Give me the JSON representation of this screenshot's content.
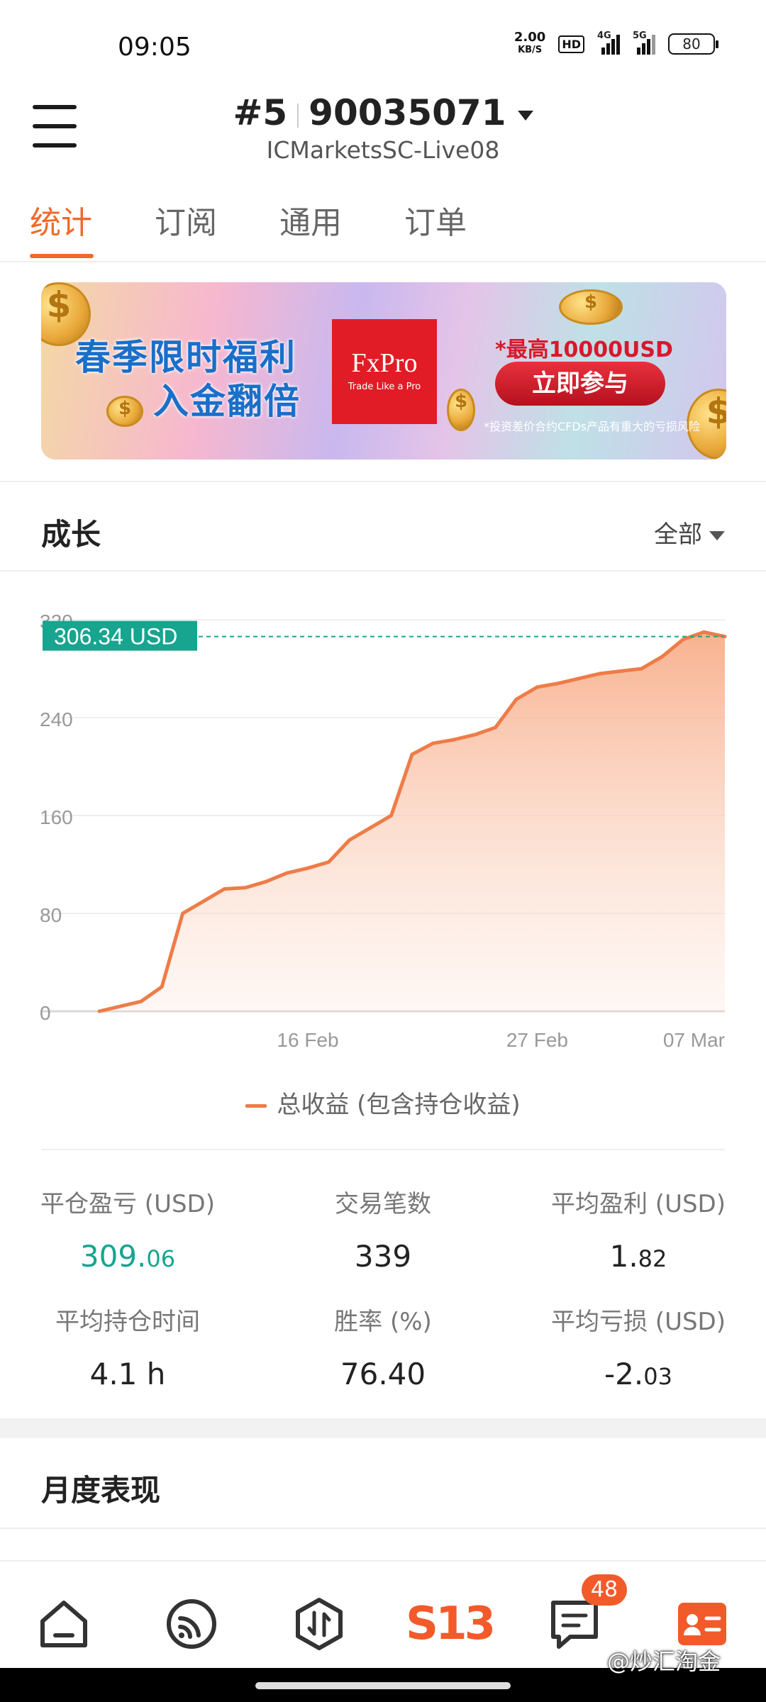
{
  "status_bar": {
    "time": "09:05",
    "net_speed": "2.00",
    "net_unit": "KB/S",
    "hd": "HD",
    "signal1_label": "4G",
    "signal2_label": "5G",
    "battery": "80"
  },
  "header": {
    "account_index": "#5",
    "account_number": "90035071",
    "server": "ICMarketsSC-Live08"
  },
  "tabs": [
    {
      "label": "统计",
      "active": true
    },
    {
      "label": "订阅",
      "active": false
    },
    {
      "label": "通用",
      "active": false
    },
    {
      "label": "订单",
      "active": false
    }
  ],
  "banner": {
    "headline_1": "春季限时福利",
    "headline_2": "入金翻倍",
    "brand": "FxPro",
    "brand_tagline": "Trade Like a Pro",
    "max_amount": "*最高10000USD",
    "cta": "立即参与",
    "risk_note": "*投资差价合约CFDs产品有重大的亏损风险"
  },
  "growth": {
    "title": "成长",
    "range": "全部",
    "current_label": "306.34 USD",
    "legend": "总收益 (包含持仓收益)"
  },
  "chart_data": {
    "type": "area",
    "x": [
      "06 Feb",
      "07 Feb",
      "08 Feb",
      "09 Feb",
      "10 Feb",
      "11 Feb",
      "12 Feb",
      "13 Feb",
      "14 Feb",
      "15 Feb",
      "16 Feb",
      "17 Feb",
      "18 Feb",
      "19 Feb",
      "20 Feb",
      "21 Feb",
      "22 Feb",
      "23 Feb",
      "24 Feb",
      "25 Feb",
      "26 Feb",
      "27 Feb",
      "28 Feb",
      "29 Feb",
      "01 Mar",
      "02 Mar",
      "03 Mar",
      "04 Mar",
      "05 Mar",
      "06 Mar",
      "07 Mar"
    ],
    "series": [
      {
        "name": "总收益 (包含持仓收益)",
        "values": [
          0,
          4,
          8,
          20,
          80,
          90,
          100,
          101,
          106,
          113,
          117,
          122,
          140,
          150,
          160,
          210,
          219,
          222,
          226,
          232,
          255,
          265,
          268,
          272,
          276,
          278,
          280,
          290,
          304,
          310,
          306.34
        ]
      }
    ],
    "xticks": [
      "16 Feb",
      "27 Feb",
      "07 Mar"
    ],
    "yticks": [
      "0",
      "80",
      "160",
      "240",
      "320"
    ],
    "ylim": [
      0,
      320
    ],
    "grid": true,
    "current_value": 306.34,
    "current_value_label": "306.34 USD",
    "colors": {
      "line": "#ee7c48",
      "fill": "#f9b79a",
      "marker": "#17a58f"
    }
  },
  "stats": {
    "closed_pl_label": "平仓盈亏 (USD)",
    "closed_pl_int": "309.",
    "closed_pl_dec": "06",
    "trades_label": "交易笔数",
    "trades": "339",
    "avg_profit_label": "平均盈利 (USD)",
    "avg_profit_int": "1.",
    "avg_profit_dec": "82",
    "avg_hold_label": "平均持仓时间",
    "avg_hold": "4.1 h",
    "win_rate_label": "胜率 (%)",
    "win_rate": "76.40",
    "avg_loss_label": "平均亏损 (USD)",
    "avg_loss_int": "-2.",
    "avg_loss_dec": "03"
  },
  "monthly": {
    "title": "月度表现"
  },
  "bottom_nav": {
    "items": [
      "home-icon",
      "feed-icon",
      "trade-icon",
      "s13-logo",
      "messages-icon",
      "profile-card-icon"
    ],
    "logo_text": "S13",
    "messages_badge": "48",
    "accent": "#f25a2a"
  },
  "watermark": "@炒汇淘金"
}
